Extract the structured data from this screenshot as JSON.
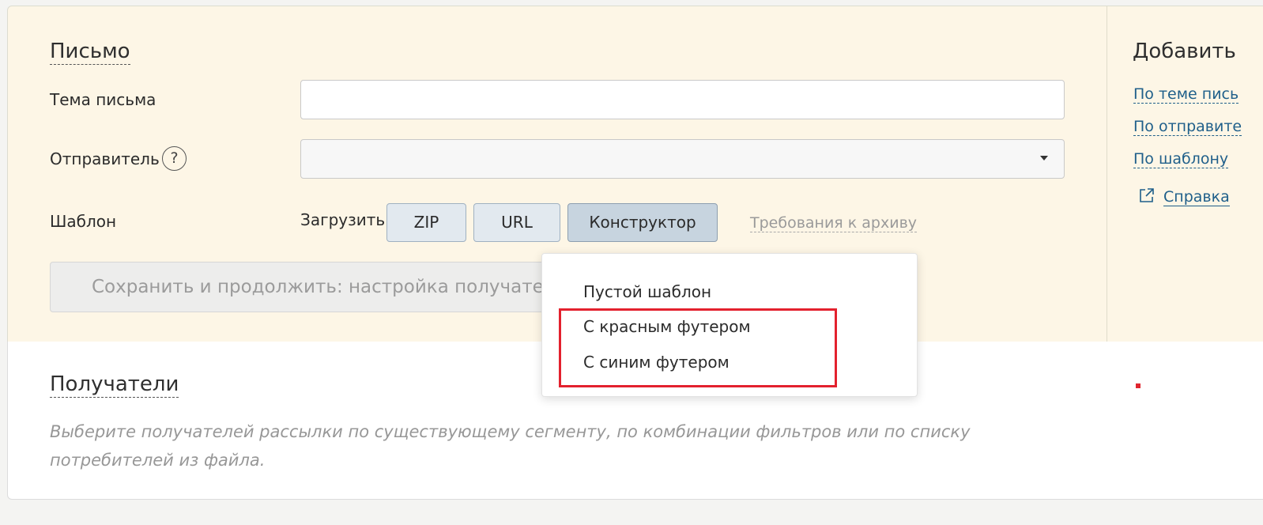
{
  "letter": {
    "title": "Письмо",
    "subject_label": "Тема письма",
    "subject_value": "",
    "sender_label": "Отправитель",
    "sender_help": "?",
    "sender_value": "",
    "template_label": "Шаблон",
    "upload_label": "Загрузить",
    "buttons": {
      "zip": "ZIP",
      "url": "URL",
      "constructor": "Конструктор"
    },
    "archive_requirements": "Требования к архиву",
    "save_button": "Сохранить и продолжить: настройка получателей"
  },
  "template_dropdown": {
    "items": [
      "Пустой шаблон",
      "С красным футером",
      "С синим футером"
    ]
  },
  "right_panel": {
    "title": "Добавить",
    "links": [
      "По теме пись",
      "По отправите",
      "По шаблону"
    ],
    "help_link": "Справка"
  },
  "recipients": {
    "title": "Получатели",
    "description": "Выберите получателей рассылки по существующему сегменту, по комбинации фильтров или по списку потребителей из файла."
  },
  "colors": {
    "accent": "#1f5f8a",
    "highlight": "#e3212e",
    "card_bg": "#fdf6e6"
  }
}
